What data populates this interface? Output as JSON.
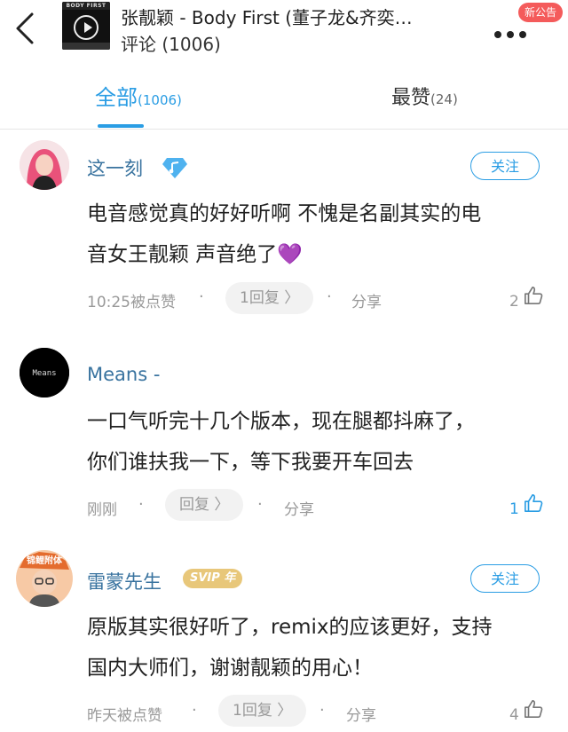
{
  "header": {
    "song_title": "张靓颖 - Body First (董子龙&齐奕…",
    "comments_label": "评论 (1006)",
    "notice_badge": "新公告",
    "cover_text": "BODY FIRST"
  },
  "tabs": {
    "all_label": "全部",
    "all_count": "(1006)",
    "hot_label": "最赞",
    "hot_count": "(24)"
  },
  "comments": [
    {
      "username": "这一刻",
      "text_line1": "电音感觉真的好好听啊 不愧是名副其实的电",
      "text_line2": "音女王靓颖 声音绝了💜",
      "time": "10:25被点赞",
      "reply": "1回复 〉",
      "share": "分享",
      "likes": "2",
      "follow": "关注"
    },
    {
      "username": "Means -",
      "avatar_text": "Means",
      "text_line1": "一口气听完十几个版本，现在腿都抖麻了，",
      "text_line2": "你们谁扶我一下，等下我要开车回去",
      "time": "刚刚",
      "reply": "回复 〉",
      "share": "分享",
      "likes": "1"
    },
    {
      "username": "雷蒙先生",
      "badge": "SVIP 年",
      "avatar_text": "锦鲤附体",
      "text_line1": "原版其实很好听了，remix的应该更好，支持",
      "text_line2": "国内大师们，谢谢靓颖的用心！",
      "time": "昨天被点赞",
      "reply": "1回复 〉",
      "share": "分享",
      "likes": "4",
      "follow": "关注"
    }
  ],
  "colors": {
    "accent": "#2a9de4",
    "username": "#39739f",
    "notice": "#f45b5b",
    "vip": "#e8c77a"
  }
}
